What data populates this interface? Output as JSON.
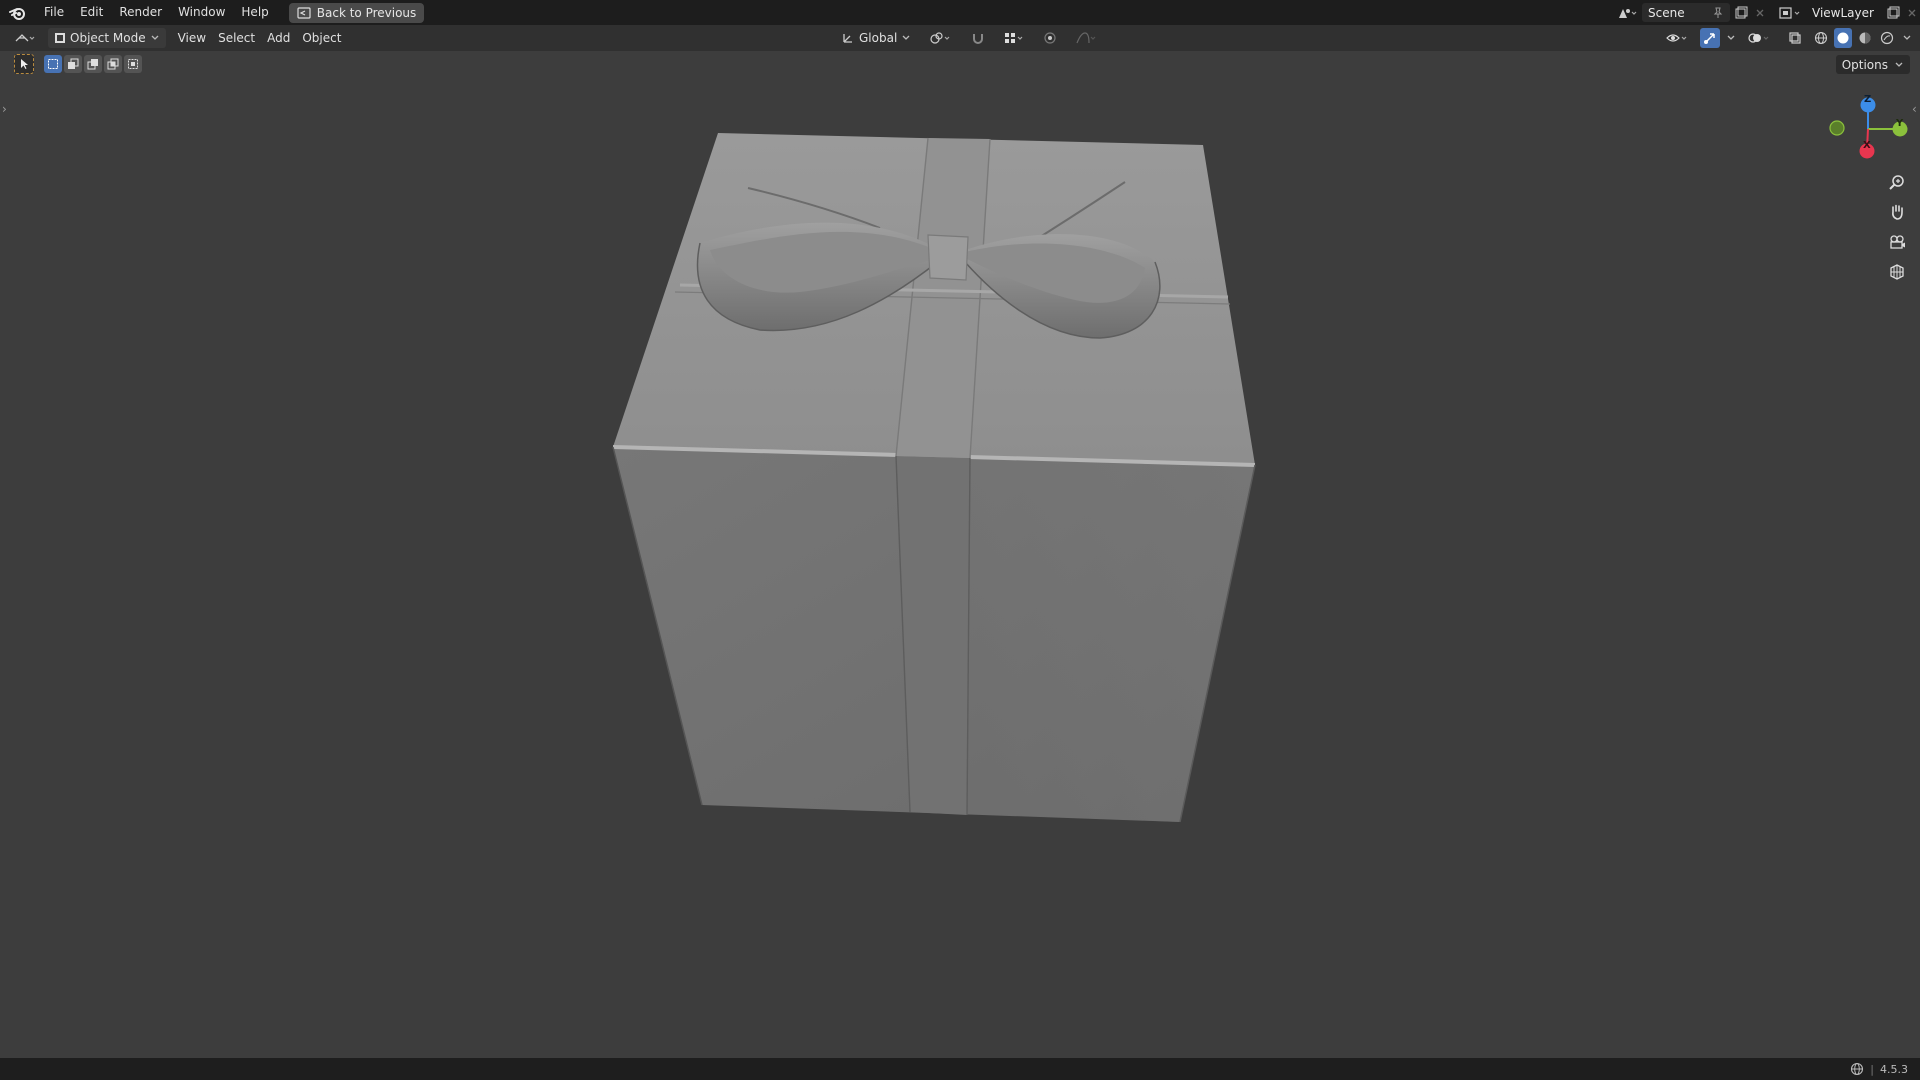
{
  "app": {
    "name": "Blender"
  },
  "menu": {
    "items": [
      "File",
      "Edit",
      "Render",
      "Window",
      "Help"
    ],
    "back_button": "Back to Previous"
  },
  "scene": {
    "label": "Scene"
  },
  "view_layer": {
    "label": "ViewLayer"
  },
  "header": {
    "mode": "Object Mode",
    "menus": [
      "View",
      "Select",
      "Add",
      "Object"
    ],
    "transform_orientation": "Global"
  },
  "toolbar": {
    "options_label": "Options"
  },
  "gizmo": {
    "z_label": "Z",
    "y_label": "Y",
    "x_label": "X"
  },
  "status": {
    "version": "4.5.3"
  },
  "icons": {
    "logo": "blender-logo-icon",
    "back": "back-to-previous-icon",
    "scene": "scene-icon",
    "view_layer": "view-layer-icon",
    "navigation": [
      "zoom-icon",
      "pan-hand-icon",
      "camera-icon",
      "ortho-grid-icon"
    ]
  },
  "colors": {
    "background": "#3d3d3d",
    "accent": "#4772b3",
    "axis_x": "#e8364f",
    "axis_y": "#8bc13c",
    "axis_z": "#3c8de8"
  }
}
